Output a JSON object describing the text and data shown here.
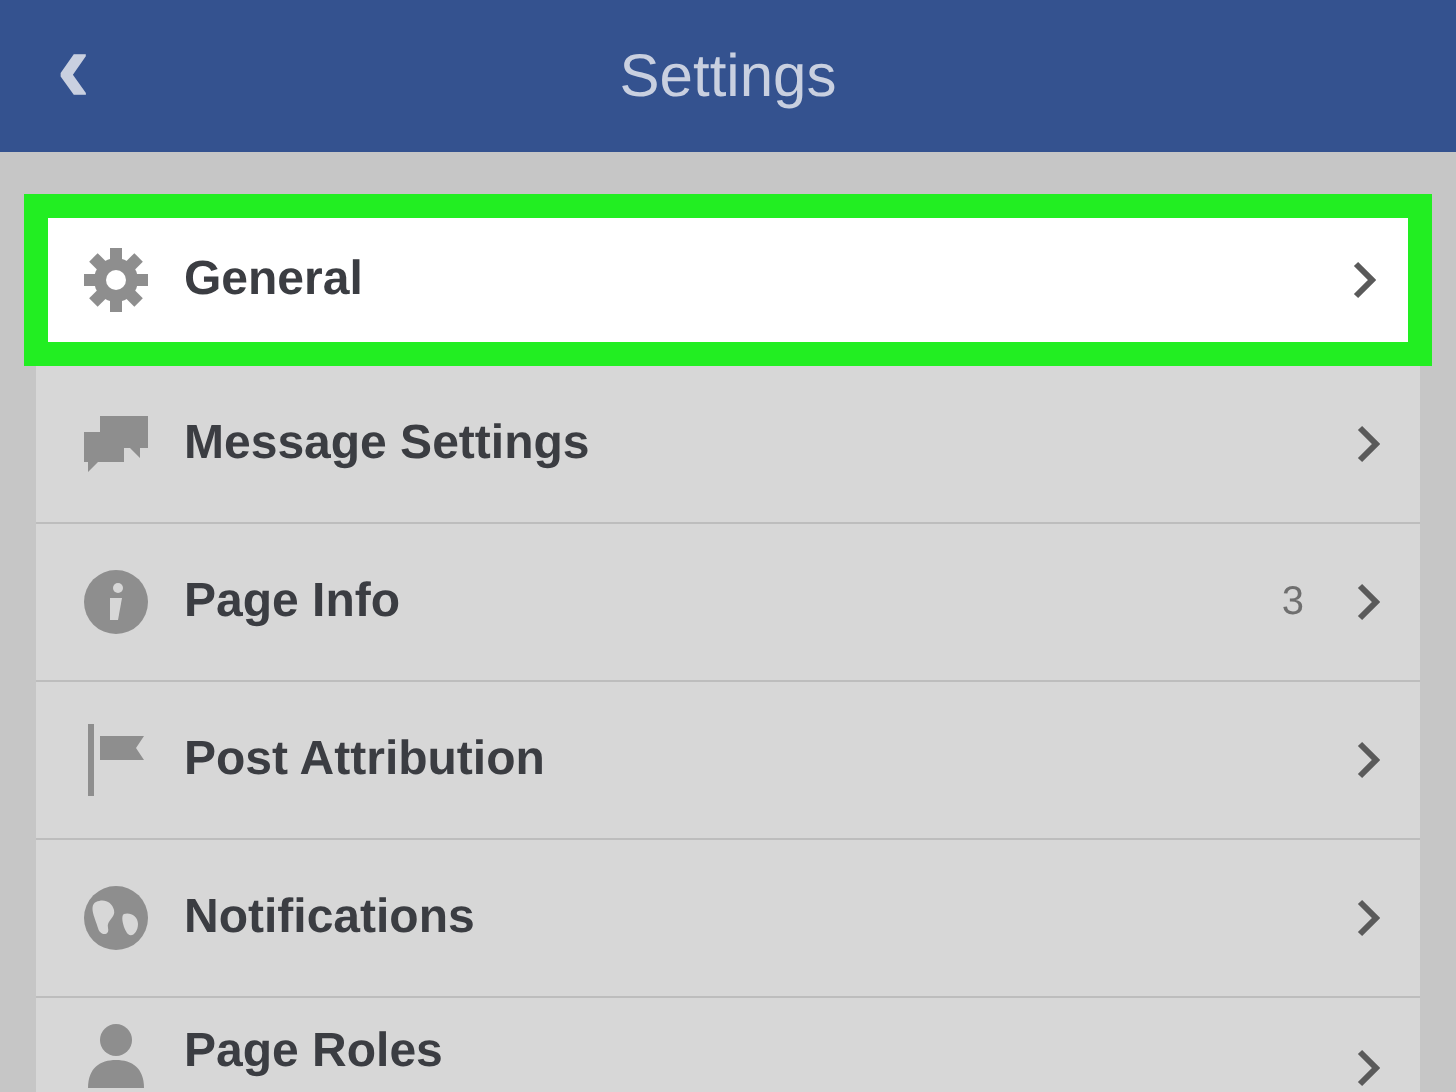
{
  "header": {
    "back": "‹",
    "title": "Settings"
  },
  "items": [
    {
      "kind": "gear",
      "label": "General",
      "selected": true
    },
    {
      "kind": "message",
      "label": "Message Settings",
      "selected": false
    },
    {
      "kind": "info",
      "label": "Page Info",
      "count": "3",
      "selected": false
    },
    {
      "kind": "flag",
      "label": "Post Attribution",
      "selected": false
    },
    {
      "kind": "globe",
      "label": "Notifications",
      "selected": false
    },
    {
      "kind": "person",
      "label": "Page Roles",
      "selected": false
    }
  ]
}
